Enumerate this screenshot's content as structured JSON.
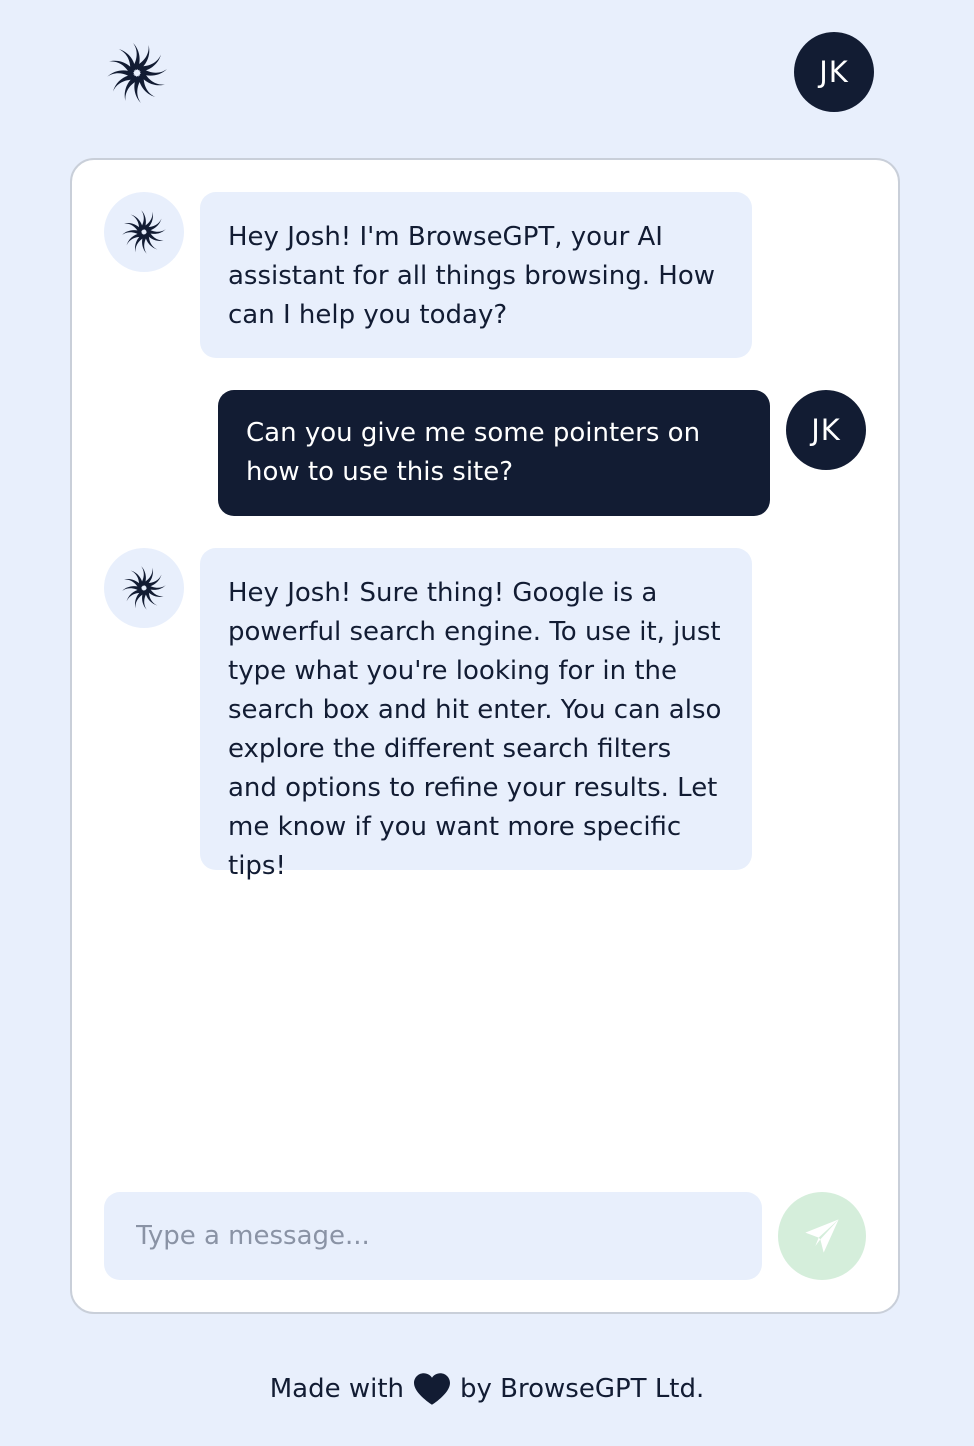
{
  "header": {
    "logo_icon": "swirl-logo-icon",
    "user_initials": "JK"
  },
  "messages": [
    {
      "role": "assistant",
      "text": "Hey Josh! I'm BrowseGPT, your AI assistant for all things browsing. How can I help you today?"
    },
    {
      "role": "user",
      "initials": "JK",
      "text": "Can you give me some pointers on how to use this site?"
    },
    {
      "role": "assistant",
      "text": "Hey Josh! Sure thing! Google is a powerful search engine. To use it, just type what you're looking for in the search box and hit enter. You can also explore the different search filters and options to refine your results. Let me know if you want more specific tips!"
    }
  ],
  "composer": {
    "placeholder": "Type a message...",
    "value": "",
    "send_icon": "paper-plane-icon"
  },
  "footer": {
    "prefix": "Made with",
    "icon": "heart-icon",
    "suffix": "by BrowseGPT Ltd."
  },
  "colors": {
    "background": "#e8effc",
    "dark": "#121c33",
    "send_button": "#d5eedb",
    "send_icon": "#ffffff"
  }
}
